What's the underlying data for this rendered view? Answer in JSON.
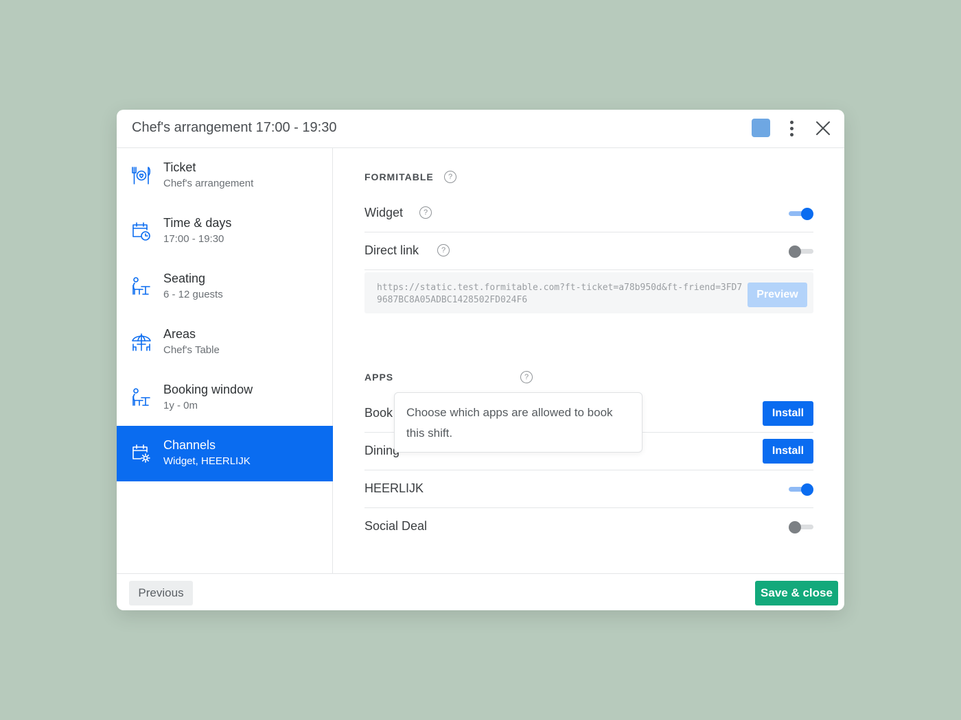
{
  "header": {
    "title": "Chef's arrangement 17:00 - 19:30",
    "swatch_color": "#6ea7e3"
  },
  "sidebar": {
    "items": [
      {
        "label": "Ticket",
        "sub": "Chef's arrangement",
        "icon": "plate-cutlery-icon"
      },
      {
        "label": "Time & days",
        "sub": "17:00 - 19:30",
        "icon": "calendar-clock-icon"
      },
      {
        "label": "Seating",
        "sub": "6 - 12 guests",
        "icon": "person-seating-icon"
      },
      {
        "label": "Areas",
        "sub": "Chef's Table",
        "icon": "umbrella-table-icon"
      },
      {
        "label": "Booking window",
        "sub": "1y - 0m",
        "icon": "person-seating-icon"
      },
      {
        "label": "Channels",
        "sub": "Widget, HEERLIJK",
        "icon": "calendar-gear-icon",
        "active": true
      }
    ]
  },
  "formitable": {
    "title": "FORMITABLE",
    "help": "?",
    "widget": {
      "label": "Widget",
      "help": "?",
      "enabled": true
    },
    "direct_link": {
      "label": "Direct link",
      "help": "?",
      "enabled": false
    },
    "url": "https://static.test.formitable.com?ft-ticket=a78b950d&ft-friend=3FD79687BC8A05ADBC1428502FD024F6",
    "preview_label": "Preview"
  },
  "apps": {
    "title": "APPS",
    "help": "?",
    "tooltip": "Choose which apps are allowed to book this shift.",
    "items": [
      {
        "label": "Book",
        "action": "Install"
      },
      {
        "label": "Dining",
        "action": "Install"
      },
      {
        "label": "HEERLIJK",
        "enabled": true
      },
      {
        "label": "Social Deal",
        "enabled": false
      }
    ]
  },
  "footer": {
    "previous_label": "Previous",
    "save_label": "Save & close"
  },
  "colors": {
    "accent": "#0a6cf0",
    "save": "#13a97b",
    "background": "#b7cabc"
  }
}
